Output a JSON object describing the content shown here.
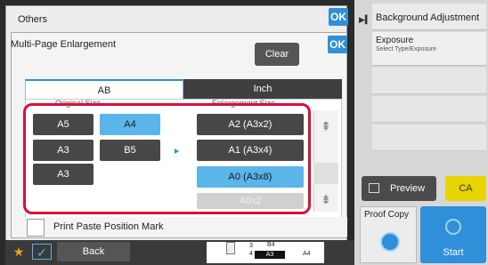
{
  "others_panel": {
    "title": "Others",
    "ok_label": "OK"
  },
  "right_panel": {
    "background_adjustment": "Background Adjustment",
    "exposure_title": "Exposure",
    "exposure_subtitle": "Select Type/Exposure",
    "preview_label": "Preview",
    "ca_label": "CA",
    "proof_copy_label": "Proof Copy",
    "start_label": "Start"
  },
  "dialog": {
    "title": "Multi-Page Enlargement",
    "clear_label": "Clear",
    "ok_label": "OK",
    "tabs": [
      {
        "label": "AB",
        "selected": true
      },
      {
        "label": "Inch",
        "selected": false
      }
    ],
    "original_size_label": "Original Size",
    "enlargement_size_label": "Enlargement Size",
    "original_sizes": [
      {
        "label": "A5",
        "selected": false
      },
      {
        "label": "A4",
        "selected": true
      },
      {
        "label": "A3",
        "selected": false
      },
      {
        "label": "B5",
        "selected": false
      },
      {
        "label": "A3",
        "selected": false
      }
    ],
    "enlargement_sizes": [
      {
        "label": "A2 (A3x2)",
        "selected": false
      },
      {
        "label": "A1 (A3x4)",
        "selected": false
      },
      {
        "label": "A0 (A3x8)",
        "selected": true
      },
      {
        "label": "A0x2",
        "selected": false,
        "disabled": true
      }
    ],
    "scroll_up_icon": "up-arrow-icon",
    "scroll_down_icon": "down-arrow-icon",
    "print_paste_label": "Print Paste Position Mark"
  },
  "bottom_bar": {
    "back_label": "Back",
    "page_preview": {
      "num_3": "3",
      "num_4": "4",
      "b4": "B4",
      "a3": "A3",
      "a4": "A4"
    }
  },
  "colors": {
    "accent": "#2f8fd8",
    "selected_size": "#5bb4ea",
    "highlight": "#d4123a",
    "ca": "#e8d400"
  }
}
